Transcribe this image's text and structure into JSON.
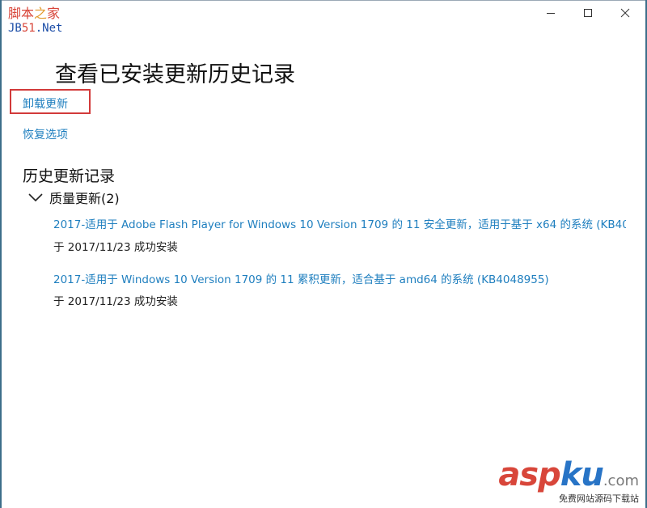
{
  "watermark_left": {
    "line1_a": "脚本",
    "line1_b": "之",
    "line1_c": "家",
    "line2_a": "JB",
    "line2_b": "51",
    "line2_c": ".Net"
  },
  "window": {
    "controls": [
      "minimize-icon",
      "maximize-icon",
      "close-icon"
    ]
  },
  "page": {
    "title": "查看已安装更新历史记录",
    "uninstall_link": "卸载更新",
    "recovery_link": "恢复选项",
    "history_heading": "历史更新记录"
  },
  "group": {
    "label": "质量更新(2)",
    "expanded": true,
    "updates": [
      {
        "title": "2017-适用于 Adobe Flash Player for Windows 10 Version 1709 的 11 安全更新，适用于基于 x64 的系统 (KB40",
        "status": "于 2017/11/23 成功安装"
      },
      {
        "title": "2017-适用于 Windows 10 Version 1709 的 11 累积更新，适合基于 amd64 的系统 (KB4048955)",
        "status": "于 2017/11/23 成功安装"
      }
    ]
  },
  "watermark_right": {
    "asp": "asp",
    "ku": "ku",
    "com": ".com",
    "tagline": "免费网站源码下载站"
  },
  "colors": {
    "link": "#1f7fbf",
    "highlight_border": "#d23a3a",
    "frame": "#3d6e8a"
  }
}
